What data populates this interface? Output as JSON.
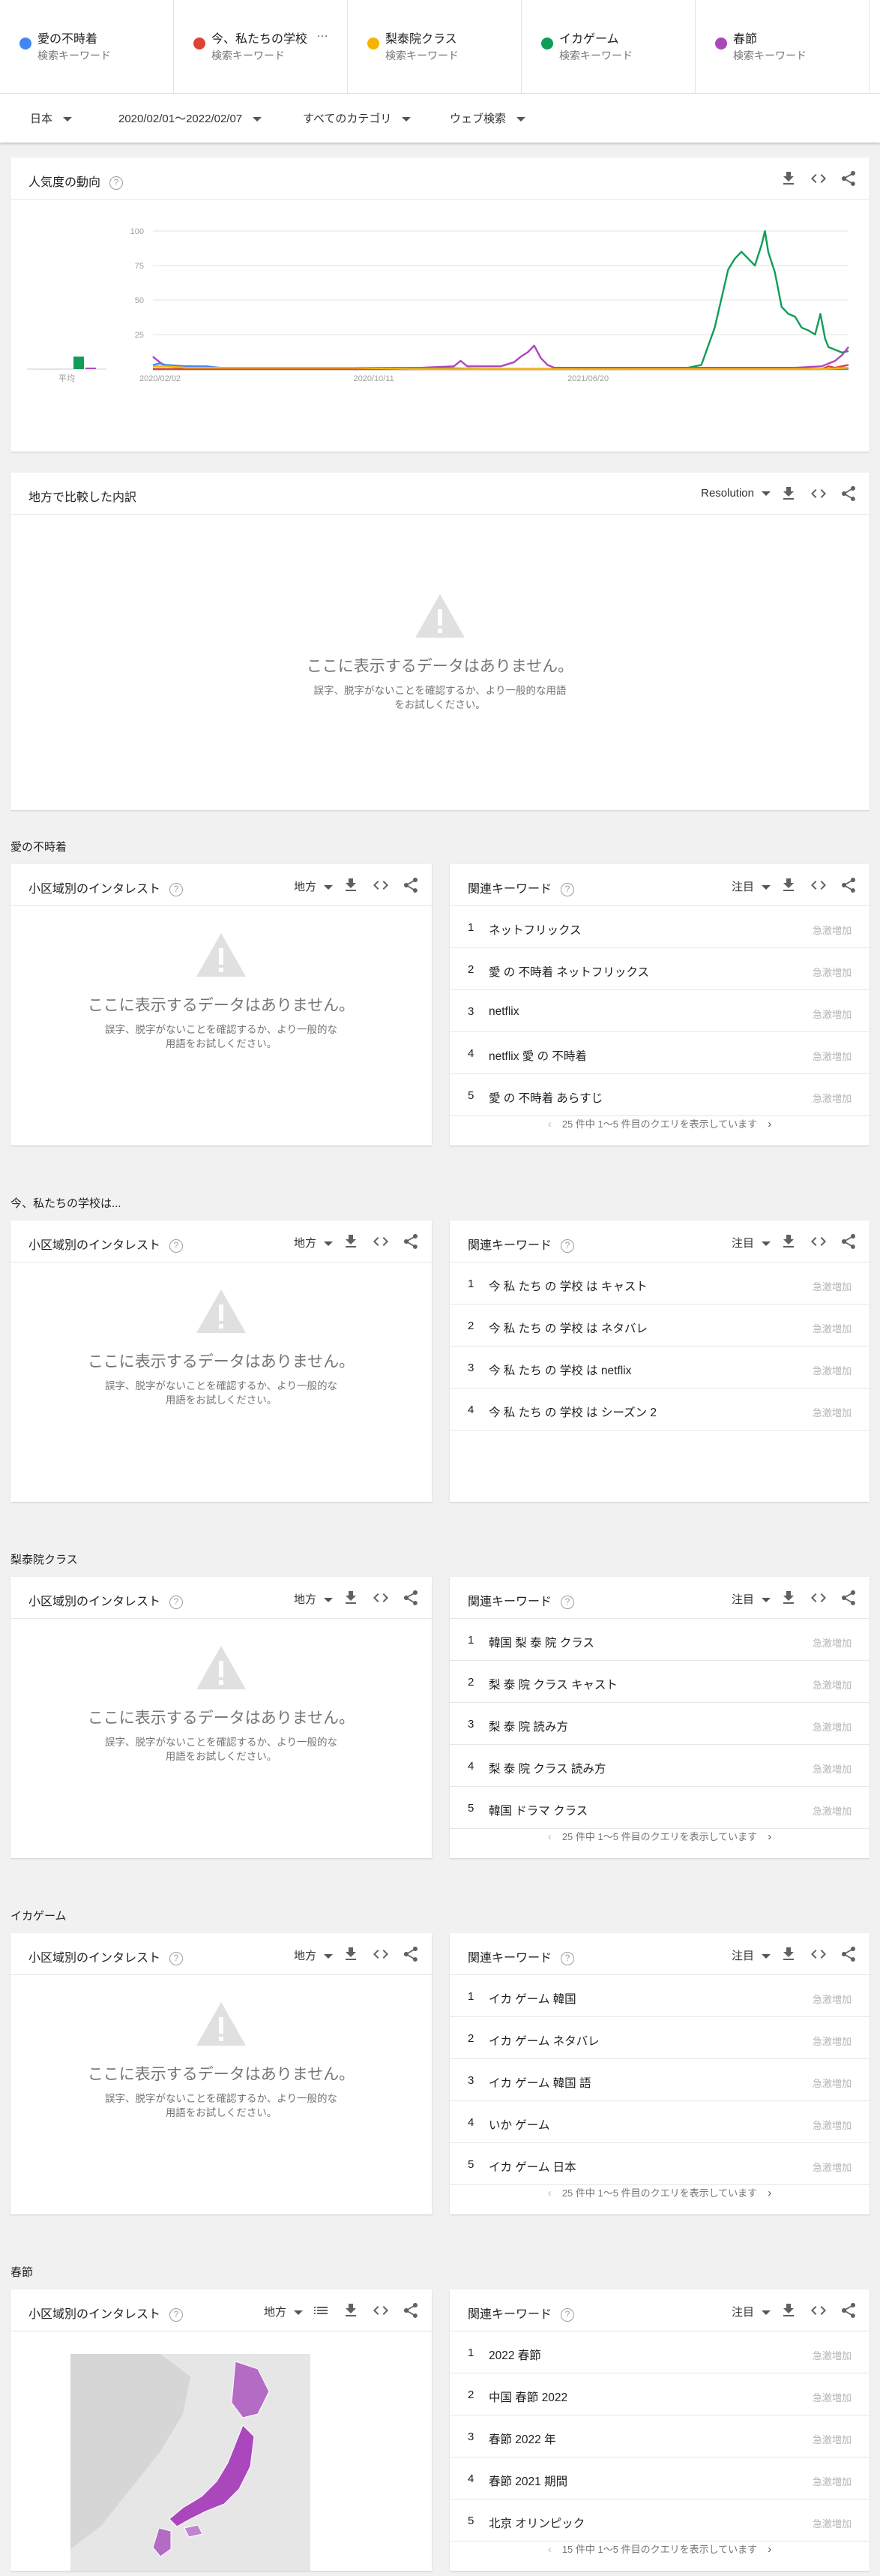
{
  "terms": [
    {
      "name": "愛の不時着",
      "sub": "検索キーワード",
      "color": "#4285f4"
    },
    {
      "name": "今、私たちの学校",
      "sub": "検索キーワード",
      "color": "#db4437",
      "more": "…"
    },
    {
      "name": "梨泰院クラス",
      "sub": "検索キーワード",
      "color": "#f4b400"
    },
    {
      "name": "イカゲーム",
      "sub": "検索キーワード",
      "color": "#0f9d58"
    },
    {
      "name": "春節",
      "sub": "検索キーワード",
      "color": "#ab47bc"
    }
  ],
  "filters": {
    "region": "日本",
    "range": "2020/02/01～2022/02/07",
    "category": "すべてのカテゴリ",
    "search_type": "ウェブ検索"
  },
  "trend": {
    "title": "人気度の動向",
    "help": "?"
  },
  "regional": {
    "title": "地方で比較した内訳",
    "select": "Resolution",
    "help": "?"
  },
  "empty": {
    "message": "ここに表示するデータはありません。",
    "hint": "誤字、脱字がないことを確認するか、より一般的な用語をお試しください。"
  },
  "labels": {
    "subregion": "小区域別のインタレスト",
    "subregion_select": "地方",
    "related": "関連キーワード",
    "related_select": "注目",
    "help": "?",
    "rising_tag": "急激増加",
    "prev": "‹",
    "next": "›"
  },
  "sections": [
    {
      "label": "愛の不時着",
      "rows": [
        "ネットフリックス",
        "愛 の 不時着 ネットフリックス",
        "netflix",
        "netflix 愛 の 不時着",
        "愛 の 不時着 あらすじ"
      ],
      "pager": "25 件中 1～5 件目のクエリを表示しています"
    },
    {
      "label": "今、私たちの学校は...",
      "rows": [
        "今 私 たち の 学校 は キャスト",
        "今 私 たち の 学校 は ネタバレ",
        "今 私 たち の 学校 は netflix",
        "今 私 たち の 学校 は シーズン 2"
      ],
      "pager": ""
    },
    {
      "label": "梨泰院クラス",
      "rows": [
        "韓国 梨 泰 院 クラス",
        "梨 泰 院 クラス キャスト",
        "梨 泰 院 読み方",
        "梨 泰 院 クラス 読み方",
        "韓国 ドラマ クラス"
      ],
      "pager": "25 件中 1～5 件目のクエリを表示しています"
    },
    {
      "label": "イカゲーム",
      "rows": [
        "イカ ゲーム 韓国",
        "イカ ゲーム ネタバレ",
        "イカ ゲーム 韓国 語",
        "いか ゲーム",
        "イカ ゲーム 日本"
      ],
      "pager": "25 件中 1～5 件目のクエリを表示しています"
    },
    {
      "label": "春節",
      "rows": [
        "2022 春節",
        "中国 春節 2022",
        "春節 2022 年",
        "春節 2021 期間",
        "北京 オリンピック"
      ],
      "pager": "15 件中 1～5 件目のクエリを表示しています"
    }
  ],
  "chart_data": {
    "type": "line",
    "title": "人気度の動向",
    "x_ticks": [
      "2020/02/02",
      "2020/10/11",
      "2021/06/20"
    ],
    "y_ticks": [
      25,
      50,
      75,
      100
    ],
    "ylim": [
      0,
      100
    ],
    "average_label": "平均",
    "average": [
      {
        "series": "愛の不時着",
        "value": 0
      },
      {
        "series": "今、私たちの学校",
        "value": 0
      },
      {
        "series": "梨泰院クラス",
        "value": 0
      },
      {
        "series": "イカゲーム",
        "value": 9
      },
      {
        "series": "春節",
        "value": 1
      }
    ],
    "series": [
      {
        "name": "イカゲーム",
        "color": "#0f9d58",
        "points": [
          [
            0,
            0
          ],
          [
            70,
            0
          ],
          [
            80,
            1
          ],
          [
            82,
            3
          ],
          [
            84,
            30
          ],
          [
            86,
            72
          ],
          [
            87,
            80
          ],
          [
            88,
            85
          ],
          [
            89,
            80
          ],
          [
            90,
            75
          ],
          [
            91,
            90
          ],
          [
            91.5,
            100
          ],
          [
            92,
            85
          ],
          [
            93,
            70
          ],
          [
            94,
            45
          ],
          [
            95,
            40
          ],
          [
            96,
            38
          ],
          [
            97,
            30
          ],
          [
            98,
            28
          ],
          [
            99,
            25
          ],
          [
            99.8,
            40
          ],
          [
            100.5,
            22
          ],
          [
            101,
            16
          ],
          [
            102,
            14
          ],
          [
            103,
            12
          ],
          [
            104,
            13
          ]
        ]
      },
      {
        "name": "春節",
        "color": "#ab47bc",
        "points": [
          [
            0,
            9
          ],
          [
            1,
            5
          ],
          [
            2,
            2
          ],
          [
            5,
            2
          ],
          [
            10,
            1
          ],
          [
            20,
            1
          ],
          [
            30,
            1
          ],
          [
            40,
            1
          ],
          [
            45,
            2
          ],
          [
            46,
            6
          ],
          [
            47,
            2
          ],
          [
            52,
            2
          ],
          [
            54,
            5
          ],
          [
            55,
            9
          ],
          [
            56,
            12
          ],
          [
            57,
            17
          ],
          [
            58,
            8
          ],
          [
            59,
            3
          ],
          [
            60,
            1
          ],
          [
            70,
            1
          ],
          [
            80,
            1
          ],
          [
            90,
            1
          ],
          [
            96,
            1
          ],
          [
            100,
            2
          ],
          [
            102,
            6
          ],
          [
            103,
            10
          ],
          [
            104,
            16
          ]
        ]
      },
      {
        "name": "愛の不時着",
        "color": "#4285f4",
        "points": [
          [
            0,
            3
          ],
          [
            1,
            4
          ],
          [
            2,
            3
          ],
          [
            5,
            2
          ],
          [
            8,
            2
          ],
          [
            10,
            1
          ],
          [
            14,
            1
          ],
          [
            20,
            1
          ],
          [
            30,
            0
          ],
          [
            40,
            1
          ],
          [
            50,
            0
          ],
          [
            60,
            0
          ],
          [
            70,
            0
          ],
          [
            80,
            0
          ],
          [
            90,
            0
          ],
          [
            100,
            0
          ],
          [
            104,
            0
          ]
        ]
      },
      {
        "name": "今、私たちの学校",
        "color": "#db4437",
        "points": [
          [
            0,
            0
          ],
          [
            90,
            0
          ],
          [
            100,
            0
          ],
          [
            101,
            2
          ],
          [
            102,
            1
          ],
          [
            103,
            2
          ],
          [
            104,
            3
          ]
        ]
      },
      {
        "name": "梨泰院クラス",
        "color": "#f4b400",
        "points": [
          [
            0,
            2
          ],
          [
            2,
            2
          ],
          [
            5,
            1
          ],
          [
            10,
            1
          ],
          [
            20,
            1
          ],
          [
            30,
            1
          ],
          [
            40,
            0
          ],
          [
            60,
            0
          ],
          [
            80,
            0
          ],
          [
            100,
            0
          ],
          [
            104,
            1
          ]
        ]
      }
    ]
  }
}
